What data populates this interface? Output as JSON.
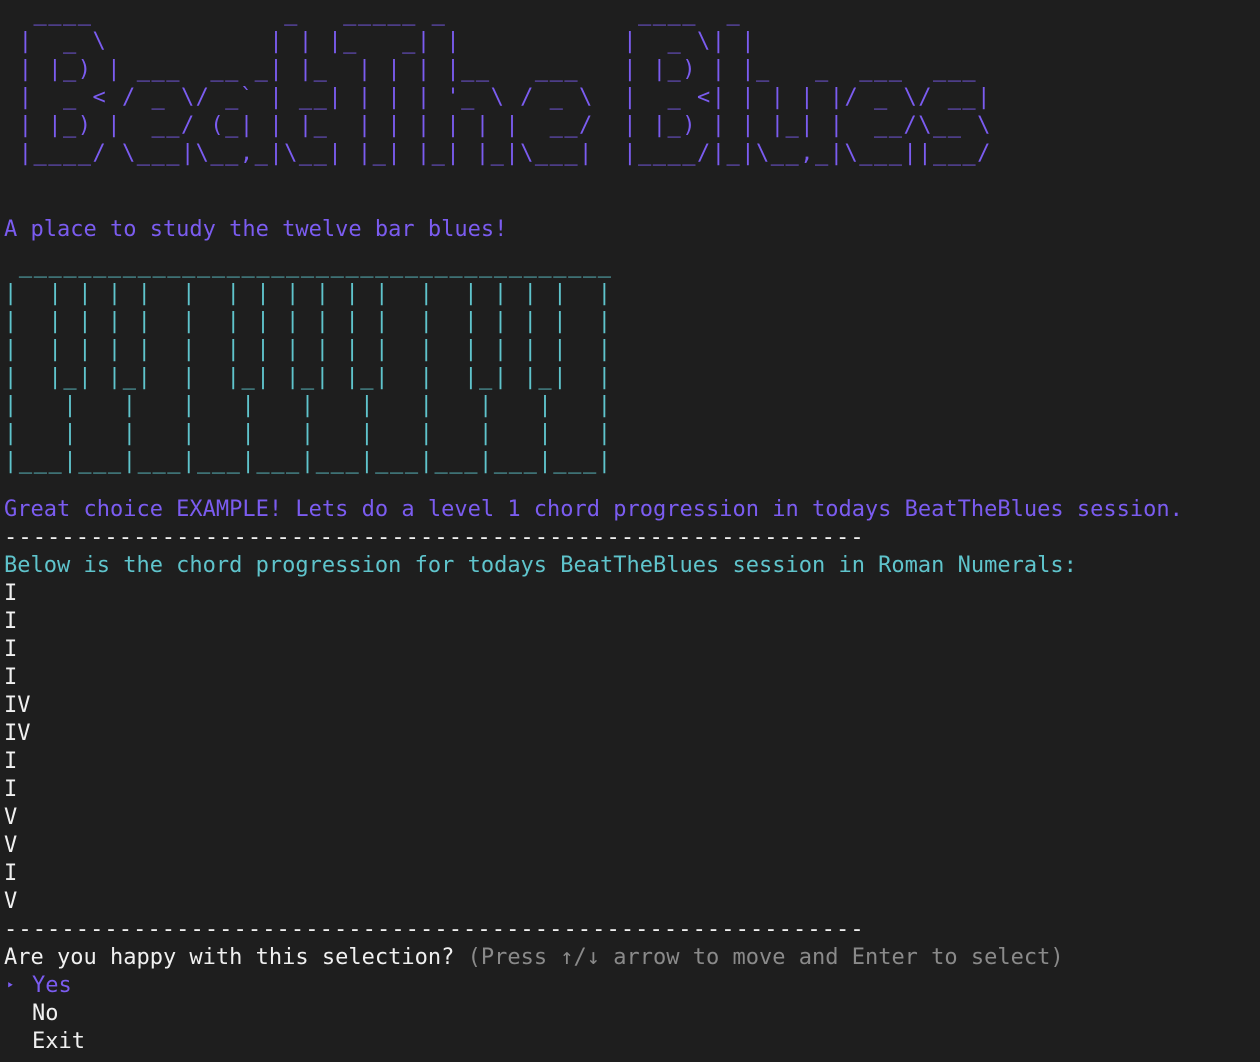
{
  "logo_ascii": "  ____             _   _____ _             ____  _\n |  _ \\           | | |_   _| |           |  _ \\| |\n | |_) | ___  __ _| |_  | | | |__   ___   | |_) | |_   _  ___  ___\n |  _ < / _ \\/ _` | __| | | | '_ \\ / _ \\  |  _ <| | | | |/ _ \\/ __|\n | |_) |  __/ (_| | |_  | | | | | |  __/  | |_) | | |_| |  __/\\__ \\\n |____/ \\___|\\__,_|\\__| |_| |_| |_|\\___|  |____/|_|\\__,_|\\___||___/",
  "tagline": "A place to study the twelve bar blues!",
  "piano_ascii": " ________________________________________\n|  | | | |  |  | | | | | |  |  | | | |  |\n|  | | | |  |  | | | | | |  |  | | | |  |\n|  | | | |  |  | | | | | |  |  | | | |  |\n|  |_| |_|  |  |_| |_| |_|  |  |_| |_|  |\n|   |   |   |   |   |   |   |   |   |   |\n|   |   |   |   |   |   |   |   |   |   |\n|___|___|___|___|___|___|___|___|___|___|",
  "greeting": "Great choice EXAMPLE! Lets do a level 1 chord progression in todays BeatTheBlues session.",
  "divider": "------------------------------------------------------------",
  "progression_heading": "Below is the chord progression for todays BeatTheBlues session in Roman Numerals:",
  "chords": [
    "I",
    "I",
    "I",
    "I",
    "IV",
    "IV",
    "I",
    "I",
    "V",
    "V",
    "I",
    "V"
  ],
  "prompt": {
    "question": "Are you happy with this selection?",
    "hint": "(Press ↑/↓ arrow to move and Enter to select)"
  },
  "menu": {
    "pointer": "‣",
    "options": [
      "Yes",
      "No",
      "Exit"
    ],
    "selected": "Yes"
  },
  "colors": {
    "background": "#1e1e1e",
    "accent_violet": "#7b5cf0",
    "accent_teal": "#5fc4cc",
    "text": "#f0f0f0",
    "hint": "#8a8a8a"
  }
}
